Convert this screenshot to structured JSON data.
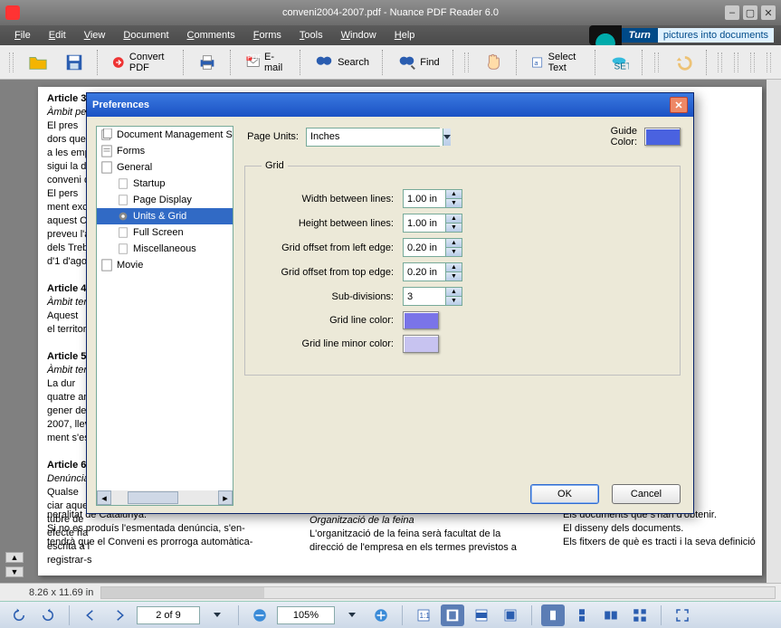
{
  "window": {
    "title": "conveni2004-2007.pdf - Nuance PDF Reader 6.0"
  },
  "menu": {
    "items": [
      "File",
      "Edit",
      "View",
      "Document",
      "Comments",
      "Forms",
      "Tools",
      "Window",
      "Help"
    ],
    "promo_turn": "Turn",
    "promo_tag": "pictures into documents"
  },
  "toolbar": {
    "convert": "Convert PDF",
    "email": "E-mail",
    "search": "Search",
    "find": "Find",
    "select_text": "Select Text"
  },
  "status": {
    "dimensions": "8.26 x 11.69 in"
  },
  "footer": {
    "page_display": "2 of 9",
    "zoom": "105%"
  },
  "dialog": {
    "title": "Preferences",
    "categories": {
      "doc_mgmt": "Document Management S",
      "forms": "Forms",
      "general": "General",
      "startup": "Startup",
      "page_display": "Page Display",
      "units_grid": "Units & Grid",
      "full_screen": "Full Screen",
      "misc": "Miscellaneous",
      "movie": "Movie"
    },
    "page_units_label": "Page Units:",
    "page_units_value": "Inches",
    "guide_color_label": "Guide Color:",
    "grid_legend": "Grid",
    "labels": {
      "width": "Width between lines:",
      "height": "Height between lines:",
      "left": "Grid offset from left edge:",
      "top": "Grid offset from top edge:",
      "subdiv": "Sub-divisions:",
      "color": "Grid line color:",
      "minor": "Grid line minor color:"
    },
    "values": {
      "width": "1.00 in",
      "height": "1.00 in",
      "left": "0.20 in",
      "top": "0.20 in",
      "subdiv": "3"
    },
    "colors": {
      "guide": "#4a62e0",
      "grid": "#7a74e8",
      "minor": "#c7c3f0"
    },
    "ok": "OK",
    "cancel": "Cancel"
  },
  "doc_text": {
    "a3h": "Article 3",
    "a3i": "Àmbit pe",
    "a3b": "El pres\ndors que\na les emp\nsigui la de\nconveni d\nEl pers\nment exci\naquest Co\npreveu l'a\ndels Treba\nd'1 d'agos",
    "a4h": "Article 4",
    "a4i": "Àmbit ter",
    "a4b": "Aquest\nel territor",
    "a5h": "Article 5",
    "a5i": "Àmbit ten",
    "a5b": "La dur\nquatre an\ngener de 2\n2007, llev\nment s'est",
    "a6h": "Article 6",
    "a6i": "Denúncia",
    "a6b": "Qualse\nciar aques\ntubre de\nefecte ha\nescrita a l\nregistrar-s",
    "tail1": "neralitat de Catalunya.\n  Si no es produís l'esmentada denúncia, s'en-\ntendrà que el Conveni es prorroga automàtica-",
    "mid_i": "Organització de la feina",
    "mid_b": "  L'organització de la feina serà facultat de la\ndirecció de l'empresa en els termes previstos a",
    "right_b": "Els documents que s'han d'obtenir.\nEl disseny dels documents.\nEls fitxers de què es tracti i la seva definició"
  }
}
